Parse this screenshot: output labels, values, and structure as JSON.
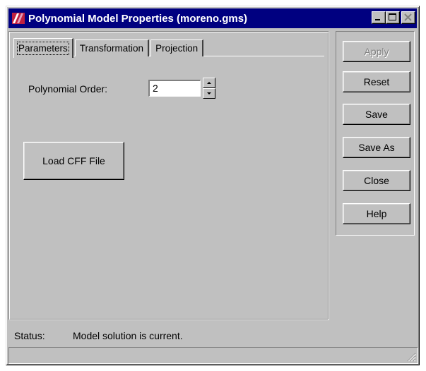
{
  "window": {
    "title": "Polynomial Model Properties (moreno.gms)",
    "title_bar_color": "#000080"
  },
  "tabs": [
    {
      "label": "Parameters",
      "active": true
    },
    {
      "label": "Transformation",
      "active": false
    },
    {
      "label": "Projection",
      "active": false
    }
  ],
  "parameters": {
    "order_label": "Polynomial Order:",
    "order_value": "2",
    "load_button": "Load CFF File"
  },
  "actions": {
    "apply": "Apply",
    "reset": "Reset",
    "save": "Save",
    "save_as": "Save As",
    "close": "Close",
    "help": "Help"
  },
  "status": {
    "label": "Status:",
    "text": "Model solution is current."
  }
}
